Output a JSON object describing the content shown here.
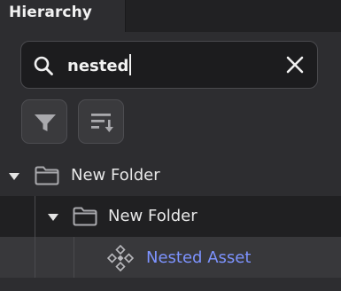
{
  "panel": {
    "tab_title": "Hierarchy"
  },
  "search": {
    "value": "nested",
    "placeholder": "",
    "icon": "search-icon",
    "clear_icon": "close-icon"
  },
  "toolbar": {
    "filter_icon": "filter-icon",
    "sort_icon": "sort-icon"
  },
  "tree": [
    {
      "label": "New Folder",
      "type": "folder",
      "expanded": true,
      "depth": 0
    },
    {
      "label": "New Folder",
      "type": "folder",
      "expanded": true,
      "depth": 1,
      "selected": true
    },
    {
      "label": "Nested Asset",
      "type": "asset",
      "depth": 2,
      "match": true
    }
  ],
  "colors": {
    "background": "#2d2d30",
    "tab_bar": "#212123",
    "search_bg": "#1c1c1e",
    "asset_text": "#7d93ff",
    "selected_row": "#202022",
    "hover_row": "#38383b"
  }
}
